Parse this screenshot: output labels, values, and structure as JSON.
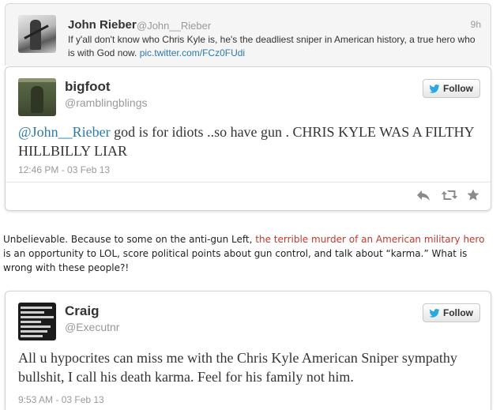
{
  "parent_tweet": {
    "name": "John Rieber",
    "handle": "@John__Rieber",
    "time": "9h",
    "text": "If y'all don't know who Chris Kyle is, he's the deadliest sniper in American history, a true hero who is with God now.",
    "link": "pic.twitter.com/FCz0FUdi"
  },
  "tweet1": {
    "name": "bigfoot",
    "handle": "@ramblingblings",
    "follow_label": "Follow",
    "mention": "@John__Rieber",
    "text": " god is for idiots ..so have gun . CHRIS KYLE WAS A FILTHY HILLBILLY LIAR",
    "timestamp": "12:46 PM - 03 Feb 13",
    "actions": [
      "reply-icon",
      "retweet-icon",
      "favorite-icon"
    ]
  },
  "article": {
    "before": "Unbelievable.  Because to some on the anti-gun Left, ",
    "link_text": "the terrible murder of an American military hero",
    "after": " is an opportunity to LOL, score political points about gun control, and talk about “karma.” What is wrong with these people?!"
  },
  "tweet2": {
    "name": "Craig",
    "handle": "@Executnr",
    "follow_label": "Follow",
    "text": "All u hypocrites can miss me with the Chris Kyle American Sniper sympathy bullshit, I call his death karma. Feel for his family not him.",
    "timestamp": "9:53 AM - 03 Feb 13"
  },
  "colors": {
    "link_blue": "#2a7ab0",
    "twitter_blue": "#2aa9e0",
    "article_link_red": "#c0392b",
    "muted_grey": "#999999"
  }
}
